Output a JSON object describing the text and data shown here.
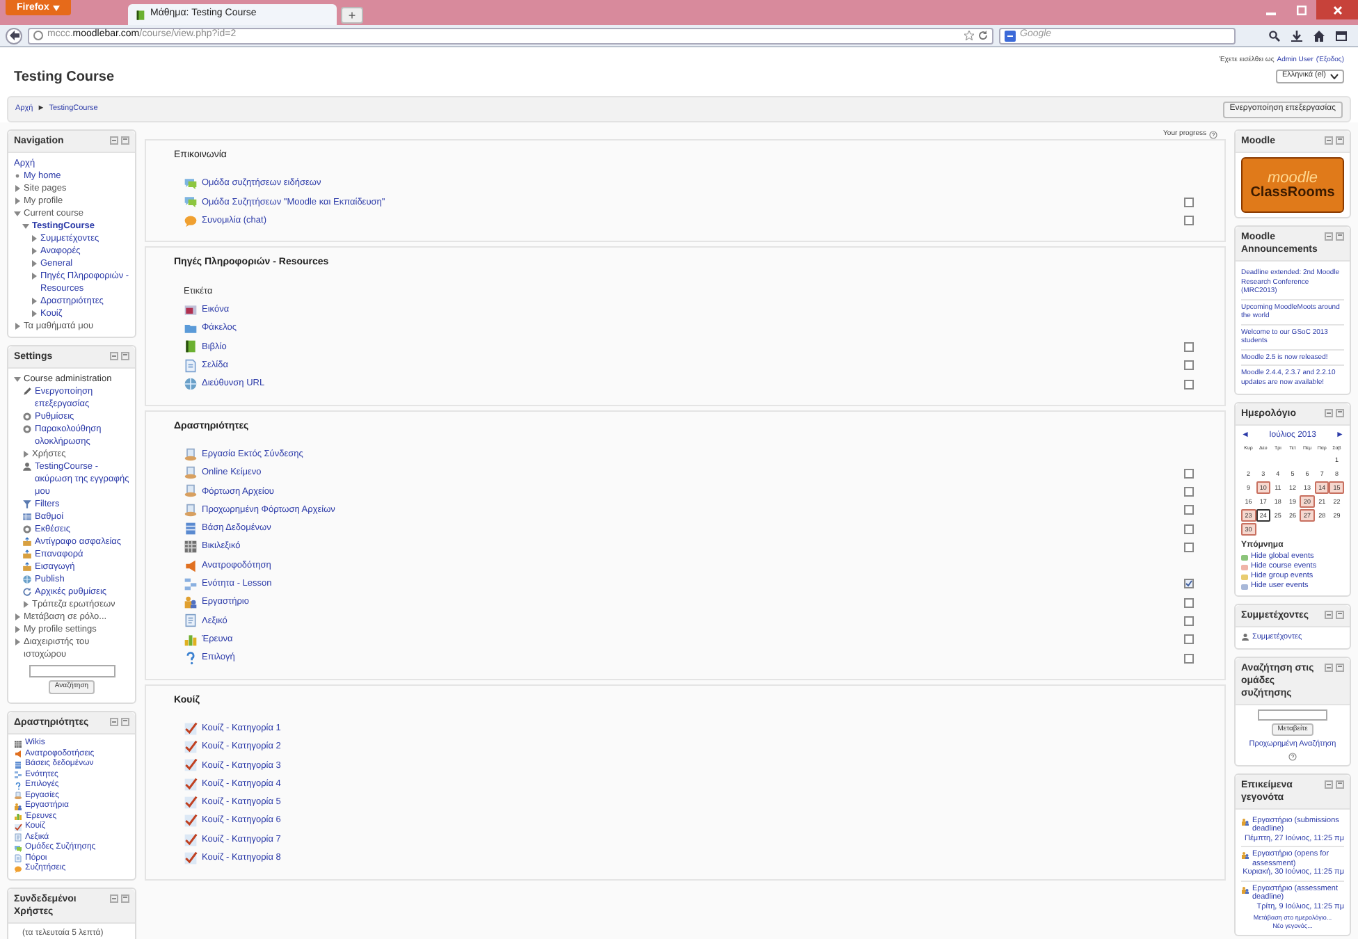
{
  "browser": {
    "menu_button": "Firefox",
    "tab": {
      "title": "Μάθημα: Testing Course",
      "selected": true
    },
    "new_tab": "+",
    "url": {
      "host_prefix": "mccc.",
      "host": "moodlebar.com",
      "path": "/course/view.php?id=2"
    },
    "search_placeholder": "Google"
  },
  "header": {
    "course_title": "Testing Course",
    "login": {
      "prefix": "Έχετε εισέλθει ως",
      "user": "Admin User",
      "logout": "(Έξοδος)"
    },
    "language": "Ελληνικά (el)",
    "breadcrumb": [
      "Αρχή",
      "TestingCourse"
    ],
    "breadcrumb_separator": "►",
    "edit_button": "Ενεργοποίηση επεξεργασίας"
  },
  "navigation": {
    "title": "Navigation",
    "items": [
      {
        "label": "Αρχή",
        "kind": "link"
      },
      {
        "label": "My home",
        "kind": "leaf"
      },
      {
        "label": "Site pages",
        "kind": "branch",
        "expanded": false
      },
      {
        "label": "My profile",
        "kind": "branch",
        "expanded": false
      },
      {
        "label": "Current course",
        "kind": "branch",
        "expanded": true,
        "children": [
          {
            "label": "TestingCourse",
            "kind": "current",
            "expanded": true,
            "children": [
              {
                "label": "Συμμετέχοντες",
                "kind": "branch",
                "expanded": false
              },
              {
                "label": "Αναφορές",
                "kind": "branch",
                "expanded": false
              },
              {
                "label": "General",
                "kind": "branch",
                "expanded": false
              },
              {
                "label": "Πηγές Πληροφοριών - Resources",
                "kind": "branch",
                "expanded": false
              },
              {
                "label": "Δραστηριότητες",
                "kind": "branch",
                "expanded": false
              },
              {
                "label": "Κουίζ",
                "kind": "branch",
                "expanded": false
              }
            ]
          }
        ]
      },
      {
        "label": "Τα μαθήματά μου",
        "kind": "branch",
        "expanded": false
      }
    ]
  },
  "settings": {
    "title": "Settings",
    "items": [
      {
        "label": "Course administration",
        "kind": "branch",
        "expanded": true,
        "children": [
          {
            "label": "Ενεργοποίηση επεξεργασίας",
            "kind": "pencil"
          },
          {
            "label": "Ρυθμίσεις",
            "kind": "gear"
          },
          {
            "label": "Παρακολούθηση ολοκλήρωσης",
            "kind": "gear"
          },
          {
            "label": "Χρήστες",
            "kind": "branch",
            "expanded": false
          },
          {
            "label": "TestingCourse - ακύρωση της εγγραφής μου",
            "kind": "user"
          },
          {
            "label": "Filters",
            "kind": "filter"
          },
          {
            "label": "Βαθμοί",
            "kind": "grades"
          },
          {
            "label": "Εκθέσεις",
            "kind": "gear"
          },
          {
            "label": "Αντίγραφο ασφαλείας",
            "kind": "backup"
          },
          {
            "label": "Επαναφορά",
            "kind": "backup"
          },
          {
            "label": "Εισαγωγή",
            "kind": "backup"
          },
          {
            "label": "Publish",
            "kind": "url"
          },
          {
            "label": "Αρχικές ρυθμίσεις",
            "kind": "reset"
          },
          {
            "label": "Τράπεζα ερωτήσεων",
            "kind": "branch",
            "expanded": false
          }
        ]
      },
      {
        "label": "Μετάβαση σε ρόλο...",
        "kind": "branch",
        "expanded": false
      },
      {
        "label": "My profile settings",
        "kind": "branch",
        "expanded": false
      },
      {
        "label": "Διαχειριστής του ιστοχώρου",
        "kind": "branch",
        "expanded": false
      }
    ],
    "search_button": "Αναζήτηση"
  },
  "activities_block": {
    "title": "Δραστηριότητες",
    "items": [
      {
        "label": "Wikis",
        "kind": "wiki"
      },
      {
        "label": "Ανατροφοδοτήσεις",
        "kind": "feedback"
      },
      {
        "label": "Βάσεις δεδομένων",
        "kind": "data"
      },
      {
        "label": "Ενότητες",
        "kind": "lesson"
      },
      {
        "label": "Επιλογές",
        "kind": "choice"
      },
      {
        "label": "Εργασίες",
        "kind": "assign"
      },
      {
        "label": "Εργαστήρια",
        "kind": "workshop"
      },
      {
        "label": "Έρευνες",
        "kind": "survey"
      },
      {
        "label": "Κουίζ",
        "kind": "quiz"
      },
      {
        "label": "Λεξικά",
        "kind": "glossary"
      },
      {
        "label": "Ομάδες Συζήτησης",
        "kind": "forum"
      },
      {
        "label": "Πόροι",
        "kind": "page"
      },
      {
        "label": "Συζητήσεις",
        "kind": "chat"
      }
    ]
  },
  "online_users": {
    "title": "Συνδεδεμένοι Χρήστες",
    "note": "(τα τελευταία 5 λεπτά)"
  },
  "course": {
    "progress_label": "Your progress",
    "sections": [
      {
        "title": "Επικοινωνία",
        "kind": "general",
        "items": [
          {
            "kind": "forum",
            "name": "Ομάδα συζητήσεων ειδήσεων"
          },
          {
            "kind": "forum",
            "name": "Ομάδα Συζητήσεων \"Moodle και Εκπαίδευση\"",
            "checkbox": {
              "checked": false
            }
          },
          {
            "kind": "chat",
            "name": "Συνομιλία (chat)",
            "checkbox": {
              "checked": false
            }
          }
        ]
      },
      {
        "title": "Πηγές Πληροφοριών - Resources",
        "kind": "topic",
        "items": [
          {
            "kind": "label",
            "name": "Ετικέτα"
          },
          {
            "kind": "image",
            "name": "Εικόνα"
          },
          {
            "kind": "folder",
            "name": "Φάκελος"
          },
          {
            "kind": "book",
            "name": "Βιβλίο",
            "checkbox": {
              "checked": false
            }
          },
          {
            "kind": "page",
            "name": "Σελίδα",
            "checkbox": {
              "checked": false
            }
          },
          {
            "kind": "url",
            "name": "Διεύθυνση URL",
            "checkbox": {
              "checked": false
            }
          }
        ]
      },
      {
        "title": "Δραστηριότητες",
        "kind": "topic",
        "items": [
          {
            "kind": "assign",
            "name": "Εργασία Εκτός Σύνδεσης"
          },
          {
            "kind": "assign",
            "name": "Online Κείμενο",
            "checkbox": {
              "checked": false
            }
          },
          {
            "kind": "assign",
            "name": "Φόρτωση Αρχείου",
            "checkbox": {
              "checked": false
            }
          },
          {
            "kind": "assign",
            "name": "Προχωρημένη Φόρτωση Αρχείων",
            "checkbox": {
              "checked": false
            }
          },
          {
            "kind": "data",
            "name": "Βάση Δεδομένων",
            "checkbox": {
              "checked": false
            }
          },
          {
            "kind": "wiki",
            "name": "Βικιλεξικό",
            "checkbox": {
              "checked": false
            }
          },
          {
            "kind": "feedback",
            "name": "Ανατροφοδότηση"
          },
          {
            "kind": "lesson",
            "name": "Ενότητα - Lesson",
            "checkbox": {
              "checked": true
            }
          },
          {
            "kind": "workshop",
            "name": "Εργαστήριο",
            "checkbox": {
              "checked": false
            }
          },
          {
            "kind": "glossary",
            "name": "Λεξικό",
            "checkbox": {
              "checked": false
            }
          },
          {
            "kind": "survey",
            "name": "Έρευνα",
            "checkbox": {
              "checked": false
            }
          },
          {
            "kind": "choice",
            "name": "Επιλογή",
            "checkbox": {
              "checked": false
            }
          }
        ]
      },
      {
        "title": "Κουίζ",
        "kind": "topic",
        "items": [
          {
            "kind": "quiz",
            "name": "Κουίζ - Κατηγορία 1"
          },
          {
            "kind": "quiz",
            "name": "Κουίζ - Κατηγορία 2"
          },
          {
            "kind": "quiz",
            "name": "Κουίζ - Κατηγορία 3"
          },
          {
            "kind": "quiz",
            "name": "Κουίζ - Κατηγορία 4"
          },
          {
            "kind": "quiz",
            "name": "Κουίζ - Κατηγορία 5"
          },
          {
            "kind": "quiz",
            "name": "Κουίζ - Κατηγορία 6"
          },
          {
            "kind": "quiz",
            "name": "Κουίζ - Κατηγορία 7"
          },
          {
            "kind": "quiz",
            "name": "Κουίζ - Κατηγορία 8"
          }
        ]
      }
    ]
  },
  "logo_block": {
    "title": "Moodle",
    "logo": {
      "line1": "moodle",
      "line2": "ClassRooms"
    }
  },
  "announcements": {
    "title": "Moodle Announcements",
    "items": [
      "Deadline extended: 2nd Moodle Research Conference (MRC2013)",
      "Upcoming MoodleMoots around the world",
      "Welcome to our GSoC 2013 students",
      "Moodle 2.5 is now released!",
      "Moodle 2.4.4, 2.3.7 and 2.2.10 updates are now available!"
    ]
  },
  "calendar": {
    "title": "Ημερολόγιο",
    "prev": "◄",
    "month": "Ιούλιος 2013",
    "next": "►",
    "weekdays": [
      "Κυρ",
      "Δευ",
      "Τρι",
      "Τετ",
      "Πεμ",
      "Παρ",
      "Σαβ"
    ],
    "weeks": [
      [
        {
          "kind": "empty"
        },
        {
          "kind": "empty"
        },
        {
          "kind": "empty"
        },
        {
          "kind": "empty"
        },
        {
          "kind": "empty"
        },
        {
          "kind": "empty"
        },
        {
          "kind": "day",
          "day": "1",
          "event": false,
          "today": false
        }
      ],
      [
        {
          "day": "2",
          "event": false,
          "today": false
        },
        {
          "day": "3",
          "event": false,
          "today": false
        },
        {
          "day": "4",
          "event": false,
          "today": false
        },
        {
          "day": "5",
          "event": false,
          "today": false
        },
        {
          "day": "6",
          "event": false,
          "today": false
        },
        {
          "day": "7",
          "event": false,
          "today": false
        },
        {
          "day": "8",
          "event": false,
          "today": false
        }
      ],
      [
        {
          "day": "9",
          "event": false,
          "today": false
        },
        {
          "day": "10",
          "event": true,
          "today": false
        },
        {
          "day": "11",
          "event": false,
          "today": false
        },
        {
          "day": "12",
          "event": false,
          "today": false
        },
        {
          "day": "13",
          "event": false,
          "today": false
        },
        {
          "day": "14",
          "event": true,
          "today": false
        },
        {
          "day": "15",
          "event": true,
          "today": false
        }
      ],
      [
        {
          "day": "16",
          "event": false,
          "today": false
        },
        {
          "day": "17",
          "event": false,
          "today": false
        },
        {
          "day": "18",
          "event": false,
          "today": false
        },
        {
          "day": "19",
          "event": false,
          "today": false
        },
        {
          "day": "20",
          "event": true,
          "today": false
        },
        {
          "day": "21",
          "event": false,
          "today": false
        },
        {
          "day": "22",
          "event": false,
          "today": false
        }
      ],
      [
        {
          "day": "23",
          "event": true,
          "today": false
        },
        {
          "day": "24",
          "event": false,
          "today": true
        },
        {
          "day": "25",
          "event": false,
          "today": false
        },
        {
          "day": "26",
          "event": false,
          "today": false
        },
        {
          "day": "27",
          "event": true,
          "today": false
        },
        {
          "day": "28",
          "event": false,
          "today": false
        },
        {
          "day": "29",
          "event": false,
          "today": false
        }
      ],
      [
        {
          "kind": "day",
          "day": "30",
          "event": true,
          "today": false
        },
        {
          "kind": "empty"
        },
        {
          "kind": "empty"
        },
        {
          "kind": "empty"
        },
        {
          "kind": "empty"
        },
        {
          "kind": "empty"
        },
        {
          "kind": "empty"
        }
      ]
    ],
    "legend_title": "Υπόμνημα",
    "legend": [
      {
        "label": "Hide global events",
        "color": "#8cc47a"
      },
      {
        "label": "Hide course events",
        "color": "#f0b4a8"
      },
      {
        "label": "Hide group events",
        "color": "#e8cc70"
      },
      {
        "label": "Hide user events",
        "color": "#a8b8d8"
      }
    ]
  },
  "participants": {
    "title": "Συμμετέχοντες",
    "link": "Συμμετέχοντες"
  },
  "forum_search": {
    "title": "Αναζήτηση στις ομάδες συζήτησης",
    "button": "Μεταβείτε",
    "advanced": "Προχωρημένη Αναζήτηση"
  },
  "upcoming": {
    "title": "Επικείμενα γεγονότα",
    "events": [
      {
        "title": "Εργαστήριο (submissions deadline)",
        "date": "Πέμπτη, 27 Ιούνιος, 11:25 πμ"
      },
      {
        "title": "Εργαστήριο (opens for assessment)",
        "date": "Κυριακή, 30 Ιούνιος, 11:25 πμ"
      },
      {
        "title": "Εργαστήριο (assessment deadline)",
        "date": "Τρίτη, 9 Ιούλιος, 11:25 πμ"
      }
    ],
    "links": [
      "Μετάβαση στο ημερολόγιο...",
      "Νέο γεγονός..."
    ]
  }
}
